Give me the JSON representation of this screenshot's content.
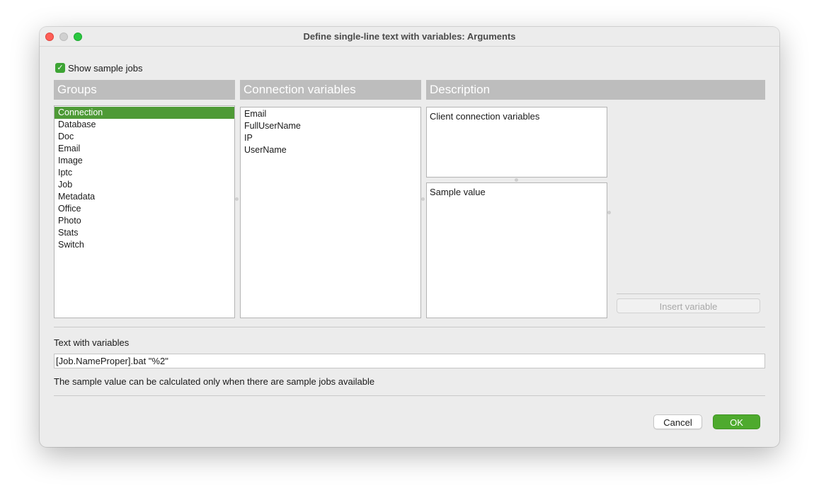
{
  "window": {
    "title": "Define single-line text with variables: Arguments"
  },
  "show_sample_jobs": {
    "label": "Show sample jobs",
    "checked": true
  },
  "columns": {
    "groups_header": "Groups",
    "variables_header": "Connection variables",
    "description_header": "Description"
  },
  "groups": [
    "Connection",
    "Database",
    "Doc",
    "Email",
    "Image",
    "Iptc",
    "Job",
    "Metadata",
    "Office",
    "Photo",
    "Stats",
    "Switch"
  ],
  "selected_group": "Connection",
  "variables": [
    "Email",
    "FullUserName",
    "IP",
    "UserName"
  ],
  "description": {
    "text": "Client connection variables",
    "sample_value": "Sample value"
  },
  "insert_button": "Insert variable",
  "text_section": {
    "label": "Text with variables",
    "value": "[Job.NameProper].bat \"%2\"",
    "note": "The sample value can be calculated only when there are sample jobs available"
  },
  "buttons": {
    "cancel": "Cancel",
    "ok": "OK"
  },
  "colors": {
    "accent_green": "#4e9a36",
    "ok_green": "#4eaa2e",
    "header_gray": "#bdbdbd"
  }
}
